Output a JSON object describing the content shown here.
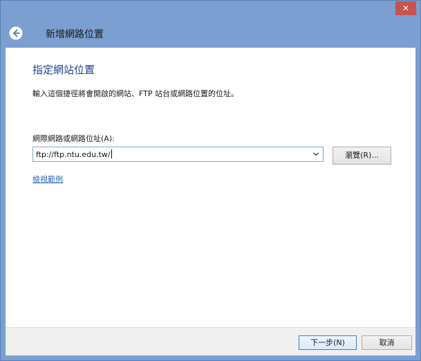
{
  "window": {
    "title": "新增網路位置",
    "close_glyph": "✕",
    "accent_color": "#7a9fd0",
    "close_color": "#c7534e"
  },
  "page": {
    "heading": "指定網站位置",
    "instruction": "輸入這個捷徑將會開啟的網站、FTP 站台或網路位置的位址。"
  },
  "address": {
    "label": "網際網路或網路位址(A):",
    "value": "ftp://ftp.ntu.edu.tw/"
  },
  "buttons": {
    "browse": "瀏覽(R)...",
    "next": "下一步(N)",
    "cancel": "取消"
  },
  "links": {
    "examples": "檢視範例"
  },
  "icons": {
    "back": "back-arrow-icon",
    "dropdown": "chevron-down-icon",
    "close": "close-icon"
  }
}
